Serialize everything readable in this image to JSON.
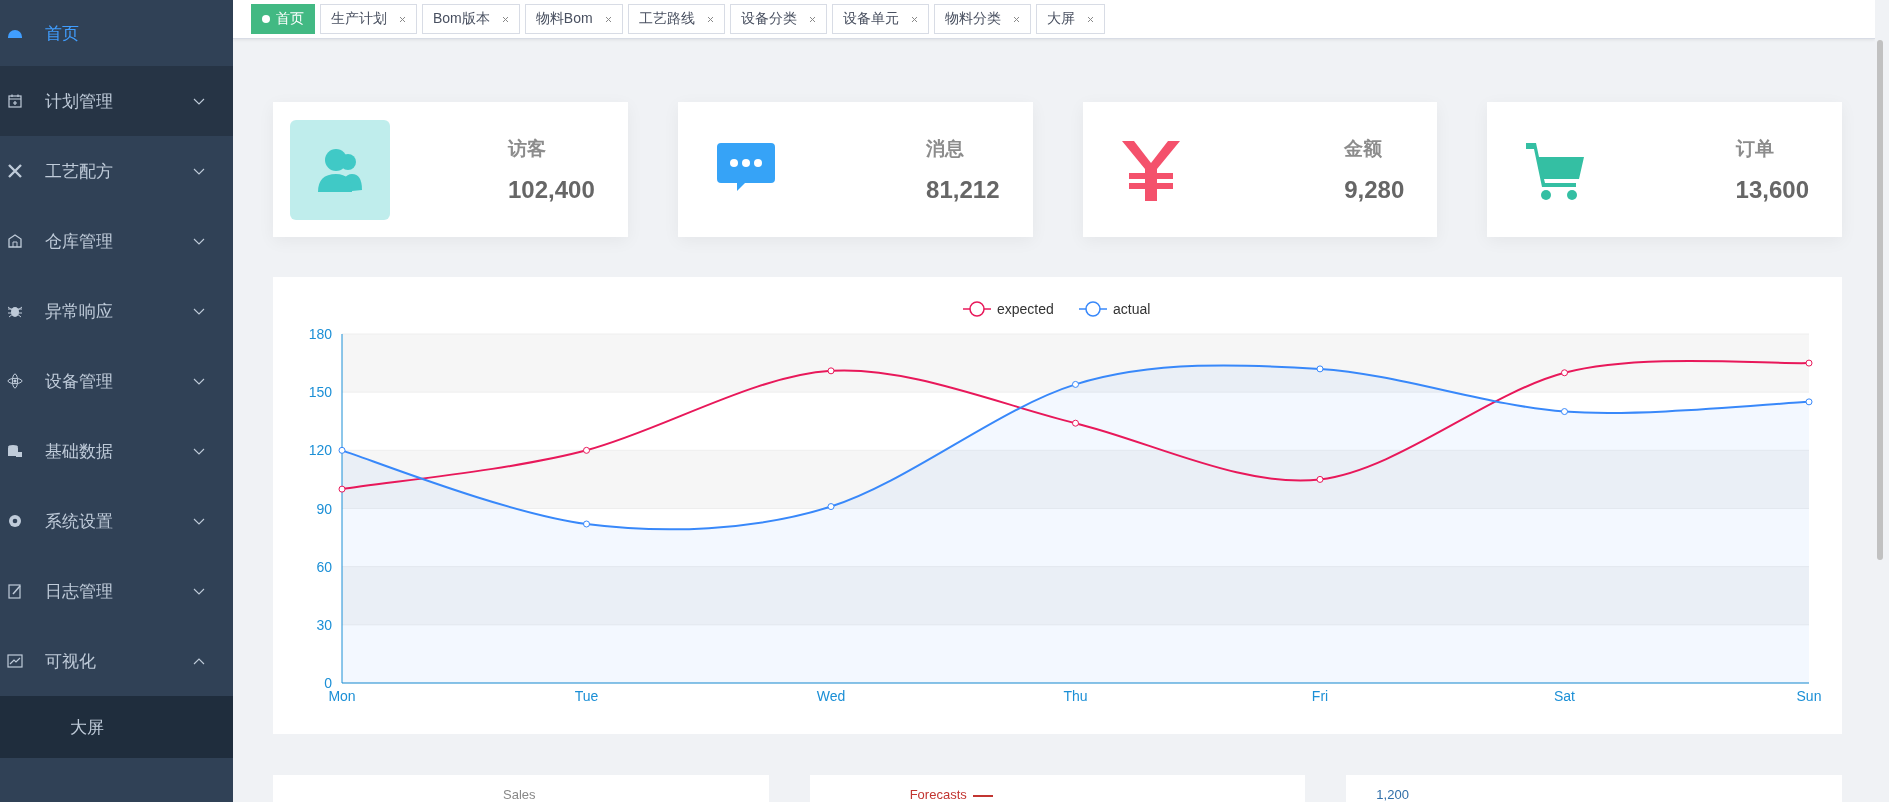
{
  "sidebar": {
    "items": [
      {
        "label": "首页",
        "selected": true,
        "highlighted": false
      },
      {
        "label": "计划管理",
        "selected": false,
        "highlighted": true,
        "expanded": false
      },
      {
        "label": "工艺配方",
        "selected": false,
        "highlighted": false,
        "expanded": false
      },
      {
        "label": "仓库管理",
        "selected": false,
        "highlighted": false,
        "expanded": false
      },
      {
        "label": "异常响应",
        "selected": false,
        "highlighted": false,
        "expanded": false
      },
      {
        "label": "设备管理",
        "selected": false,
        "highlighted": false,
        "expanded": false
      },
      {
        "label": "基础数据",
        "selected": false,
        "highlighted": false,
        "expanded": false
      },
      {
        "label": "系统设置",
        "selected": false,
        "highlighted": false,
        "expanded": false
      },
      {
        "label": "日志管理",
        "selected": false,
        "highlighted": false,
        "expanded": false
      },
      {
        "label": "可视化",
        "selected": false,
        "highlighted": false,
        "expanded": true,
        "children": [
          {
            "label": "大屏",
            "selected": false
          }
        ]
      }
    ]
  },
  "tabs": [
    {
      "label": "首页",
      "selected": true,
      "closable": false
    },
    {
      "label": "生产计划",
      "selected": false,
      "closable": true
    },
    {
      "label": "Bom版本",
      "selected": false,
      "closable": true
    },
    {
      "label": "物料Bom",
      "selected": false,
      "closable": true
    },
    {
      "label": "工艺路线",
      "selected": false,
      "closable": true
    },
    {
      "label": "设备分类",
      "selected": false,
      "closable": true
    },
    {
      "label": "设备单元",
      "selected": false,
      "closable": true
    },
    {
      "label": "物料分类",
      "selected": false,
      "closable": true
    },
    {
      "label": "大屏",
      "selected": false,
      "closable": true
    }
  ],
  "stats": [
    {
      "kind": "visitors",
      "label": "访客",
      "value": "102,400",
      "color": "#40c9c6"
    },
    {
      "kind": "messages",
      "label": "消息",
      "value": "81,212",
      "color": "#36a3f7"
    },
    {
      "kind": "money",
      "label": "金额",
      "value": "9,280",
      "color": "#f4516c"
    },
    {
      "kind": "orders",
      "label": "订单",
      "value": "13,600",
      "color": "#34bfa3"
    }
  ],
  "line_panel": {
    "chart_data": {
      "type": "line",
      "grid": true,
      "legend": true,
      "categories": [
        "Mon",
        "Tue",
        "Wed",
        "Thu",
        "Fri",
        "Sat",
        "Sun"
      ],
      "ylim": [
        0,
        180
      ],
      "yticks": [
        0,
        30,
        60,
        90,
        120,
        150,
        180
      ],
      "series": [
        {
          "name": "expected",
          "color": "#e8185a",
          "marker": "circle",
          "values": [
            100,
            120,
            161,
            134,
            105,
            160,
            165
          ]
        },
        {
          "name": "actual",
          "color": "#3888fa",
          "marker": "circle",
          "type": "area",
          "values": [
            120,
            82,
            91,
            154,
            162,
            140,
            145
          ]
        }
      ]
    }
  },
  "bottom_panels": [
    {
      "kind": "title",
      "text": "Sales"
    },
    {
      "kind": "legend",
      "text": "Forecasts"
    },
    {
      "kind": "axis",
      "text": "1,200"
    }
  ]
}
